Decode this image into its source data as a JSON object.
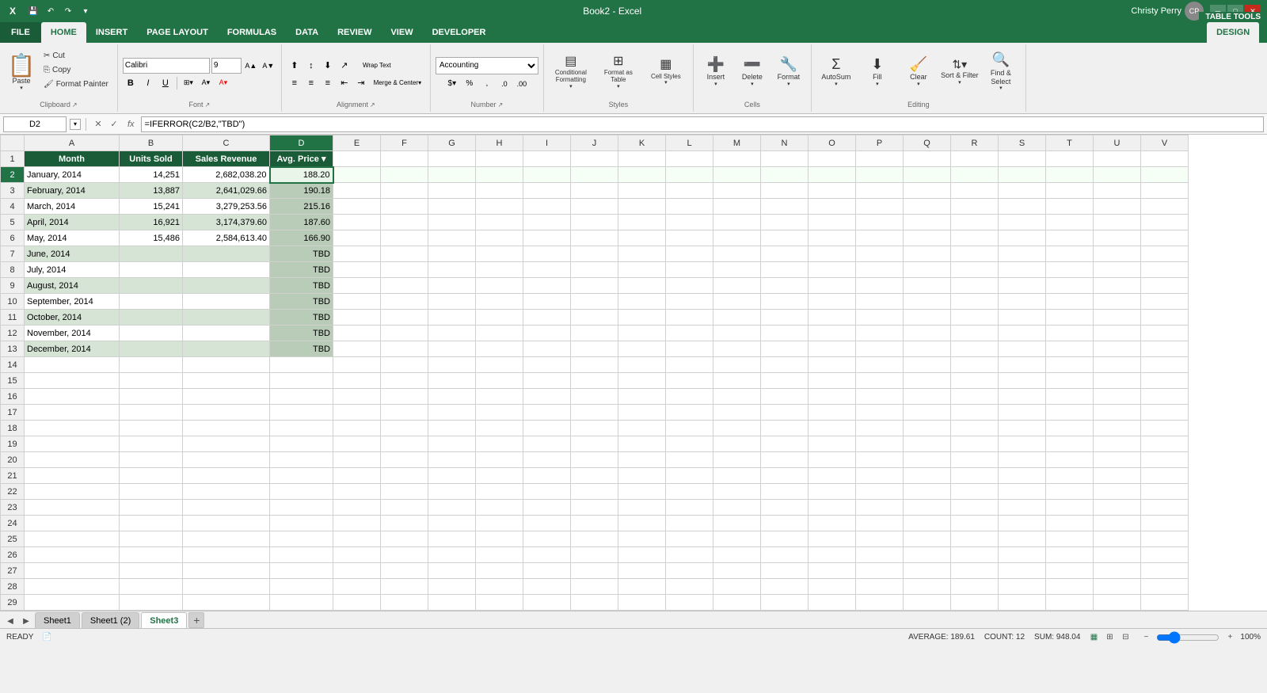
{
  "app": {
    "title": "Book2 - Excel",
    "table_tools_label": "TABLE TOOLS"
  },
  "user": {
    "name": "Christy Perry",
    "initials": "CP"
  },
  "tabs": {
    "table_tools_tab": "DESIGN",
    "items": [
      "FILE",
      "HOME",
      "INSERT",
      "PAGE LAYOUT",
      "FORMULAS",
      "DATA",
      "REVIEW",
      "VIEW",
      "DEVELOPER",
      "DESIGN"
    ]
  },
  "ribbon": {
    "clipboard_group": "Clipboard",
    "paste_label": "Paste",
    "cut_label": "Cut",
    "copy_label": "Copy",
    "format_painter_label": "Format Painter",
    "font_group": "Font",
    "font_name": "Calibri",
    "font_size": "9",
    "bold_label": "B",
    "italic_label": "I",
    "underline_label": "U",
    "alignment_group": "Alignment",
    "wrap_text_label": "Wrap Text",
    "merge_center_label": "Merge & Center",
    "number_group": "Number",
    "number_format": "Accounting",
    "styles_group": "Styles",
    "conditional_formatting_label": "Conditional Formatting",
    "format_as_table_label": "Format as Table",
    "cell_styles_label": "Cell Styles",
    "cells_group": "Cells",
    "insert_label": "Insert",
    "delete_label": "Delete",
    "format_label": "Format",
    "editing_group": "Editing",
    "autosum_label": "AutoSum",
    "fill_label": "Fill",
    "clear_label": "Clear",
    "sort_filter_label": "Sort & Filter",
    "find_select_label": "Find & Select"
  },
  "formula_bar": {
    "cell_ref": "D2",
    "formula": "=IFERROR(C2/B2,\"TBD\")"
  },
  "spreadsheet": {
    "columns": [
      "",
      "A",
      "B",
      "C",
      "D",
      "E",
      "F",
      "G",
      "H",
      "I",
      "J",
      "K",
      "L",
      "M",
      "N",
      "O",
      "P",
      "Q",
      "R",
      "S",
      "T",
      "U",
      "V"
    ],
    "headers": [
      "Month",
      "Units Sold",
      "Sales Revenue",
      "Avg. Price"
    ],
    "rows": [
      {
        "num": 1,
        "a": "Month",
        "b": "Units Sold",
        "c": "Sales Revenue",
        "d": "Avg. Price",
        "is_header": true
      },
      {
        "num": 2,
        "a": "January, 2014",
        "b": "14,251",
        "c": "2,682,038.20",
        "d": "188.20",
        "is_tbd": false
      },
      {
        "num": 3,
        "a": "February, 2014",
        "b": "13,887",
        "c": "2,641,029.66",
        "d": "190.18",
        "is_tbd": false
      },
      {
        "num": 4,
        "a": "March, 2014",
        "b": "15,241",
        "c": "3,279,253.56",
        "d": "215.16",
        "is_tbd": false
      },
      {
        "num": 5,
        "a": "April, 2014",
        "b": "16,921",
        "c": "3,174,379.60",
        "d": "187.60",
        "is_tbd": false
      },
      {
        "num": 6,
        "a": "May, 2014",
        "b": "15,486",
        "c": "2,584,613.40",
        "d": "166.90",
        "is_tbd": false
      },
      {
        "num": 7,
        "a": "June, 2014",
        "b": "",
        "c": "",
        "d": "TBD",
        "is_tbd": true
      },
      {
        "num": 8,
        "a": "July, 2014",
        "b": "",
        "c": "",
        "d": "TBD",
        "is_tbd": true
      },
      {
        "num": 9,
        "a": "August, 2014",
        "b": "",
        "c": "",
        "d": "TBD",
        "is_tbd": true
      },
      {
        "num": 10,
        "a": "September, 2014",
        "b": "",
        "c": "",
        "d": "TBD",
        "is_tbd": true
      },
      {
        "num": 11,
        "a": "October, 2014",
        "b": "",
        "c": "",
        "d": "TBD",
        "is_tbd": true
      },
      {
        "num": 12,
        "a": "November, 2014",
        "b": "",
        "c": "",
        "d": "TBD",
        "is_tbd": true
      },
      {
        "num": 13,
        "a": "December, 2014",
        "b": "",
        "c": "",
        "d": "TBD",
        "is_tbd": true
      },
      {
        "num": 14,
        "a": "",
        "b": "",
        "c": "",
        "d": "",
        "is_tbd": false
      },
      {
        "num": 15,
        "a": "",
        "b": "",
        "c": "",
        "d": "",
        "is_tbd": false
      },
      {
        "num": 16,
        "a": "",
        "b": "",
        "c": "",
        "d": "",
        "is_tbd": false
      },
      {
        "num": 17,
        "a": "",
        "b": "",
        "c": "",
        "d": "",
        "is_tbd": false
      },
      {
        "num": 18,
        "a": "",
        "b": "",
        "c": "",
        "d": "",
        "is_tbd": false
      },
      {
        "num": 19,
        "a": "",
        "b": "",
        "c": "",
        "d": "",
        "is_tbd": false
      },
      {
        "num": 20,
        "a": "",
        "b": "",
        "c": "",
        "d": "",
        "is_tbd": false
      },
      {
        "num": 21,
        "a": "",
        "b": "",
        "c": "",
        "d": "",
        "is_tbd": false
      },
      {
        "num": 22,
        "a": "",
        "b": "",
        "c": "",
        "d": "",
        "is_tbd": false
      },
      {
        "num": 23,
        "a": "",
        "b": "",
        "c": "",
        "d": "",
        "is_tbd": false
      },
      {
        "num": 24,
        "a": "",
        "b": "",
        "c": "",
        "d": "",
        "is_tbd": false
      },
      {
        "num": 25,
        "a": "",
        "b": "",
        "c": "",
        "d": "",
        "is_tbd": false
      },
      {
        "num": 26,
        "a": "",
        "b": "",
        "c": "",
        "d": "",
        "is_tbd": false
      },
      {
        "num": 27,
        "a": "",
        "b": "",
        "c": "",
        "d": "",
        "is_tbd": false
      },
      {
        "num": 28,
        "a": "",
        "b": "",
        "c": "",
        "d": "",
        "is_tbd": false
      },
      {
        "num": 29,
        "a": "",
        "b": "",
        "c": "",
        "d": "",
        "is_tbd": false
      }
    ]
  },
  "sheet_tabs": {
    "items": [
      "Sheet1",
      "Sheet1 (2)",
      "Sheet3"
    ],
    "active": "Sheet3"
  },
  "status_bar": {
    "ready": "READY",
    "average": "AVERAGE: 189.61",
    "count": "COUNT: 12",
    "sum": "SUM: 948.04",
    "zoom": "100%"
  }
}
